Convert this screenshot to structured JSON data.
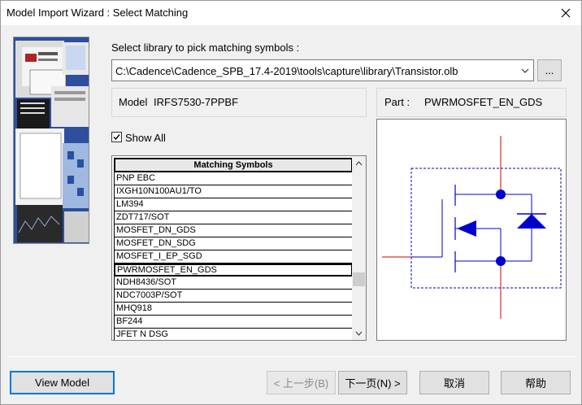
{
  "window": {
    "title": "Model Import Wizard : Select Matching"
  },
  "library": {
    "prompt": "Select library to pick matching symbols :",
    "path": "C:\\Cadence\\Cadence_SPB_17.4-2019\\tools\\capture\\library\\Transistor.olb",
    "browse_label": "..."
  },
  "model": {
    "label": "Model",
    "name": "IRFS7530-7PPBF"
  },
  "part": {
    "label": "Part :",
    "name": "PWRMOSFET_EN_GDS"
  },
  "show_all": {
    "label": "Show All",
    "checked": true
  },
  "symbols": {
    "header": "Matching Symbols",
    "items": [
      "PNP EBC",
      "IXGH10N100AU1/TO",
      "LM394",
      "ZDT717/SOT",
      "MOSFET_DN_GDS",
      "MOSFET_DN_SDG",
      "MOSFET_I_EP_SGD",
      "PWRMOSFET_EN_GDS",
      "NDH8436/SOT",
      "NDC7003P/SOT",
      "MHQ918",
      "BF244",
      "JFET N DSG"
    ],
    "selected": "PWRMOSFET_EN_GDS"
  },
  "buttons": {
    "view_model": "View Model",
    "back": "< 上一步(B)",
    "next": "下一页(N) >",
    "cancel": "取消",
    "help": "帮助"
  },
  "colors": {
    "symbol_blue": "#0000cc",
    "pin_red": "#cc0000",
    "selection_border": "#000000",
    "focus_blue": "#0078d7"
  }
}
